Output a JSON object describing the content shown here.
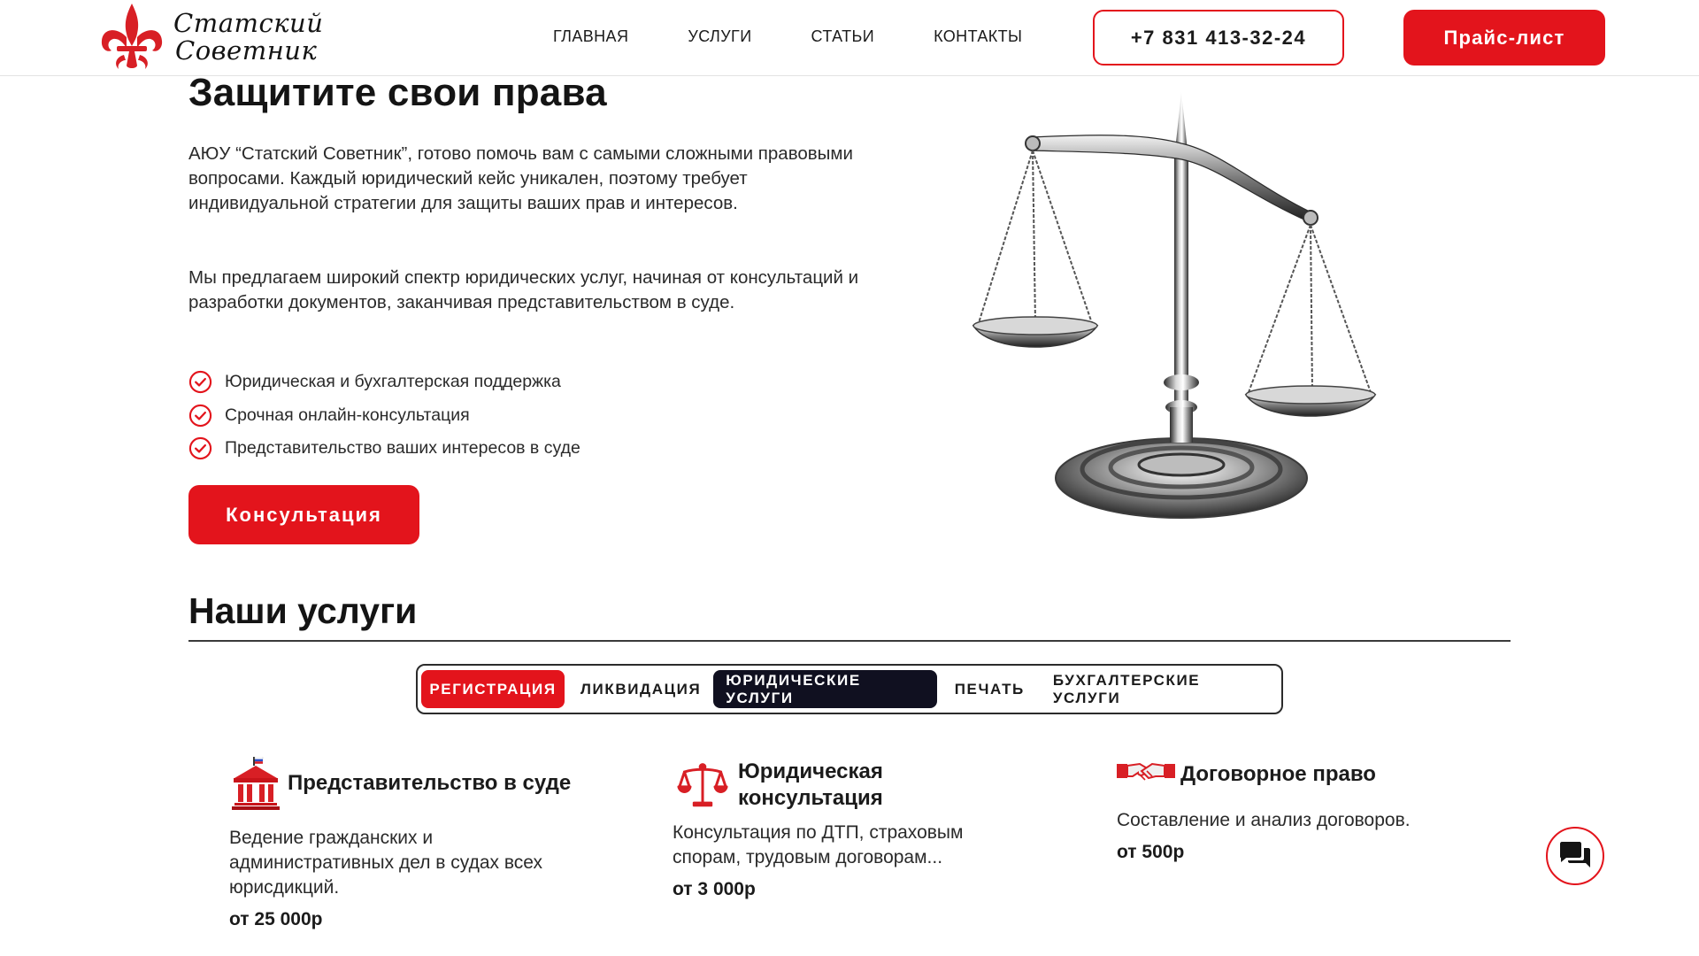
{
  "brand": {
    "line1": "Статский",
    "line2": "Советник",
    "color": "#e3141c"
  },
  "nav": {
    "items": [
      "ГЛАВНАЯ",
      "УСЛУГИ",
      "СТАТЬИ",
      "КОНТАКТЫ"
    ],
    "phone": "+7 831 413-32-24",
    "price_label": "Прайс-лист"
  },
  "hero": {
    "title": "Защитите свои права",
    "p1": "АЮУ “Статский Советник”, готово помочь вам с самыми сложными правовыми вопросами. Каждый юридический кейс уникален, поэтому требует индивидуальной стратегии для защиты ваших прав и интересов.",
    "p2": "Мы предлагаем широкий спектр юридических услуг, начиная от консультаций и разработки документов, заканчивая представительством в суде.",
    "checks": [
      "Юридическая и бухгалтерская поддержка",
      "Срочная онлайн-консультация",
      "Представительство ваших интересов в суде"
    ],
    "cta": "Консультация"
  },
  "services": {
    "title": "Наши услуги",
    "tabs": [
      "РЕГИСТРАЦИЯ",
      "ЛИКВИДАЦИЯ",
      "ЮРИДИЧЕСКИЕ УСЛУГИ",
      "ПЕЧАТЬ",
      "БУХГАЛТЕРСКИЕ УСЛУГИ"
    ],
    "cards": [
      {
        "icon": "courthouse-icon",
        "title": "Представительство в суде",
        "desc": "Ведение гражданских и административных дел в судах всех юрисдикций.",
        "price": "от 25 000р"
      },
      {
        "icon": "scales-icon",
        "title": "Юридическая консультация",
        "desc": "Консультация по ДТП, страховым спорам, трудовым договорам...",
        "price": "от 3 000р"
      },
      {
        "icon": "handshake-icon",
        "title": "Договорное право",
        "desc": "Составление и анализ договоров.",
        "price": "от 500р"
      }
    ]
  },
  "colors": {
    "accent": "#e3141c",
    "tab_active": "#101020"
  }
}
